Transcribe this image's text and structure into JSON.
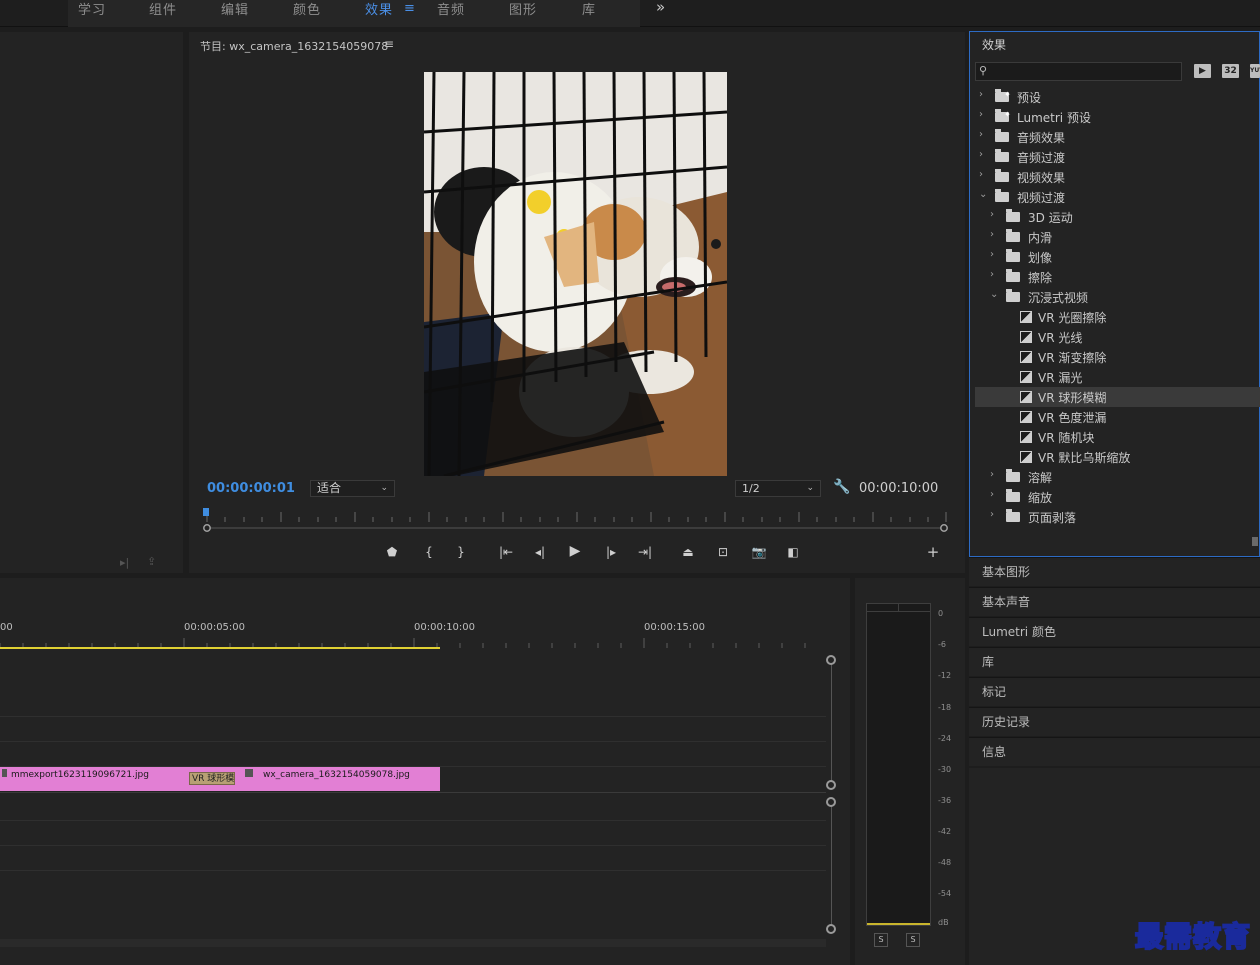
{
  "workspace": {
    "tabs": [
      {
        "label": "学习"
      },
      {
        "label": "组件"
      },
      {
        "label": "编辑"
      },
      {
        "label": "颜色"
      },
      {
        "label": "效果",
        "active": true
      },
      {
        "label": "音频"
      },
      {
        "label": "图形"
      },
      {
        "label": "库"
      }
    ],
    "active_menu_icon": "≡",
    "more_icon": "»"
  },
  "program": {
    "title": "节目: wx_camera_1632154059078",
    "menu_icon": "≡",
    "current_timecode": "00:00:00:01",
    "zoom": "适合",
    "resolution": "1/2",
    "duration_timecode": "00:00:10:00",
    "playhead_position": 0.0
  },
  "effects": {
    "title": "效果",
    "search_placeholder": "",
    "tools": [
      "32",
      "YUV"
    ],
    "tree": [
      {
        "label": "预设",
        "level": 0,
        "expanded": false,
        "kind": "preset-folder"
      },
      {
        "label": "Lumetri 预设",
        "level": 0,
        "expanded": false,
        "kind": "preset-folder"
      },
      {
        "label": "音频效果",
        "level": 0,
        "expanded": false,
        "kind": "folder"
      },
      {
        "label": "音频过渡",
        "level": 0,
        "expanded": false,
        "kind": "folder"
      },
      {
        "label": "视频效果",
        "level": 0,
        "expanded": false,
        "kind": "folder"
      },
      {
        "label": "视频过渡",
        "level": 0,
        "expanded": true,
        "kind": "folder"
      },
      {
        "label": "3D 运动",
        "level": 1,
        "expanded": false,
        "kind": "folder"
      },
      {
        "label": "内滑",
        "level": 1,
        "expanded": false,
        "kind": "folder"
      },
      {
        "label": "划像",
        "level": 1,
        "expanded": false,
        "kind": "folder"
      },
      {
        "label": "擦除",
        "level": 1,
        "expanded": false,
        "kind": "folder"
      },
      {
        "label": "沉浸式视频",
        "level": 1,
        "expanded": true,
        "kind": "folder"
      },
      {
        "label": "VR 光圈擦除",
        "level": 2,
        "kind": "effect"
      },
      {
        "label": "VR 光线",
        "level": 2,
        "kind": "effect"
      },
      {
        "label": "VR 渐变擦除",
        "level": 2,
        "kind": "effect"
      },
      {
        "label": "VR 漏光",
        "level": 2,
        "kind": "effect"
      },
      {
        "label": "VR 球形模糊",
        "level": 2,
        "kind": "effect",
        "selected": true
      },
      {
        "label": "VR 色度泄漏",
        "level": 2,
        "kind": "effect"
      },
      {
        "label": "VR 随机块",
        "level": 2,
        "kind": "effect"
      },
      {
        "label": "VR 默比乌斯缩放",
        "level": 2,
        "kind": "effect"
      },
      {
        "label": "溶解",
        "level": 1,
        "expanded": false,
        "kind": "folder"
      },
      {
        "label": "缩放",
        "level": 1,
        "expanded": false,
        "kind": "folder"
      },
      {
        "label": "页面剥落",
        "level": 1,
        "expanded": false,
        "kind": "folder"
      }
    ]
  },
  "side_panels": [
    {
      "label": "基本图形"
    },
    {
      "label": "基本声音"
    },
    {
      "label": "Lumetri 颜色"
    },
    {
      "label": "库"
    },
    {
      "label": "标记"
    },
    {
      "label": "历史记录"
    },
    {
      "label": "信息"
    }
  ],
  "timeline": {
    "time_labels": [
      "00",
      "00:00:05:00",
      "00:00:10:00",
      "00:00:15:00"
    ],
    "clips": [
      {
        "name": "mmexport1623119096721.jpg"
      },
      {
        "name": "wx_camera_1632154059078.jpg"
      }
    ],
    "transition": {
      "name": "VR 球形模"
    }
  },
  "audio_meter": {
    "db_labels": [
      "0",
      "-6",
      "-12",
      "-18",
      "-24",
      "-30",
      "-36",
      "-42",
      "-48",
      "-54",
      "dB"
    ],
    "solo_labels": [
      "S",
      "S"
    ]
  },
  "watermark": "最需教育",
  "colors": {
    "accent": "#4a8fe6",
    "clip": "#e27fd4",
    "transition": "#b8a074",
    "work_area": "#e0d033",
    "panel_focus_border": "#2d6bc4"
  }
}
